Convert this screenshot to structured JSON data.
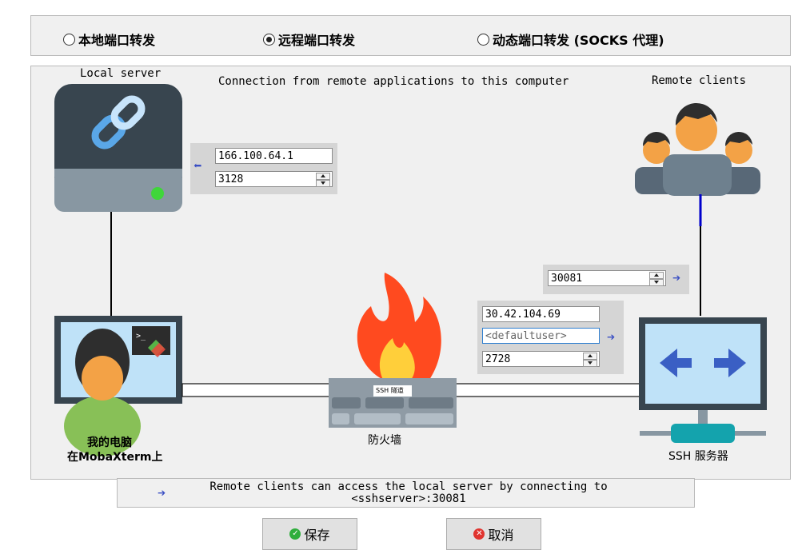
{
  "mode_options": [
    {
      "label": "本地端口转发",
      "selected": false
    },
    {
      "label": "远程端口转发",
      "selected": true
    },
    {
      "label": "动态端口转发 (SOCKS 代理)",
      "selected": false
    }
  ],
  "diagram": {
    "local_server_label": "Local server",
    "heading": "Connection from remote applications to this computer",
    "remote_clients_label": "Remote clients",
    "my_computer_label_line1": "我的电脑",
    "my_computer_label_line2": "在MobaXterm上",
    "firewall_label": "防火墙",
    "tunnel_label": "SSH 隧道",
    "ssh_server_label": "SSH 服务器"
  },
  "local_target": {
    "host": "166.100.64.1",
    "port": "3128"
  },
  "remote_port": "30081",
  "ssh_server": {
    "host": "30.42.104.69",
    "user_placeholder": "<defaultuser>",
    "port": "2728"
  },
  "status_message_line1": "Remote clients can access the local server by connecting to",
  "status_message_line2": "<sshserver>:30081",
  "buttons": {
    "save": "保存",
    "cancel": "取消"
  },
  "colors": {
    "accent_arrow": "#3a4fc4",
    "flame": "#ff4a1f",
    "screen": "#bfe2f8",
    "save_icon": "#2fae3c",
    "cancel_icon": "#e0342f"
  }
}
